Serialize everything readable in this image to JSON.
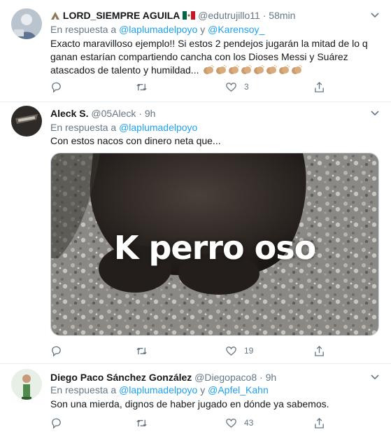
{
  "tweets": [
    {
      "name": "LORD_SIEMPRE AGUILA",
      "name_prefix_emoji": "eagle-icon",
      "name_suffix_emoji": "mexico-flag-icon",
      "handle": "@edutrujillo11",
      "dot": "·",
      "time": "58min",
      "reply_prefix": "En respuesta a",
      "reply_to_1": "@laplumadelpoyo",
      "reply_joiner": "y",
      "reply_to_2": "@Karensoy_",
      "text_line1": "Exacto maravilloso ejemplo!! Si estos 2 pendejos jugarán la mitad de lo q",
      "text_line2": "ganan estarían compartiendo cancha con los Dioses Messi y Suárez",
      "text_line3": "atascados de talento y humildad...",
      "clap_emoji_count": 8,
      "replies": "",
      "retweets": "",
      "likes": "3"
    },
    {
      "name": "Aleck S.",
      "handle": "@05Aleck",
      "dot": "·",
      "time": "9h",
      "reply_prefix": "En respuesta a",
      "reply_to_1": "@laplumadelpoyo",
      "text_line1": "Con estos nacos con dinero neta que...",
      "media_caption": "K perro oso",
      "replies": "",
      "retweets": "",
      "likes": "19"
    },
    {
      "name": "Diego Paco Sánchez González",
      "handle": "@Diegopaco8",
      "dot": "·",
      "time": "9h",
      "reply_prefix": "En respuesta a",
      "reply_to_1": "@laplumadelpoyo",
      "reply_joiner": "y",
      "reply_to_2": "@Apfel_Kahn",
      "text_line1": "Son una mierda, dignos de haber jugado en dónde ya sabemos.",
      "replies": "",
      "retweets": "",
      "likes": "43"
    }
  ],
  "colors": {
    "link": "#1da1f2",
    "muted": "#657786",
    "text": "#14171a",
    "border": "#e6ecf0"
  }
}
